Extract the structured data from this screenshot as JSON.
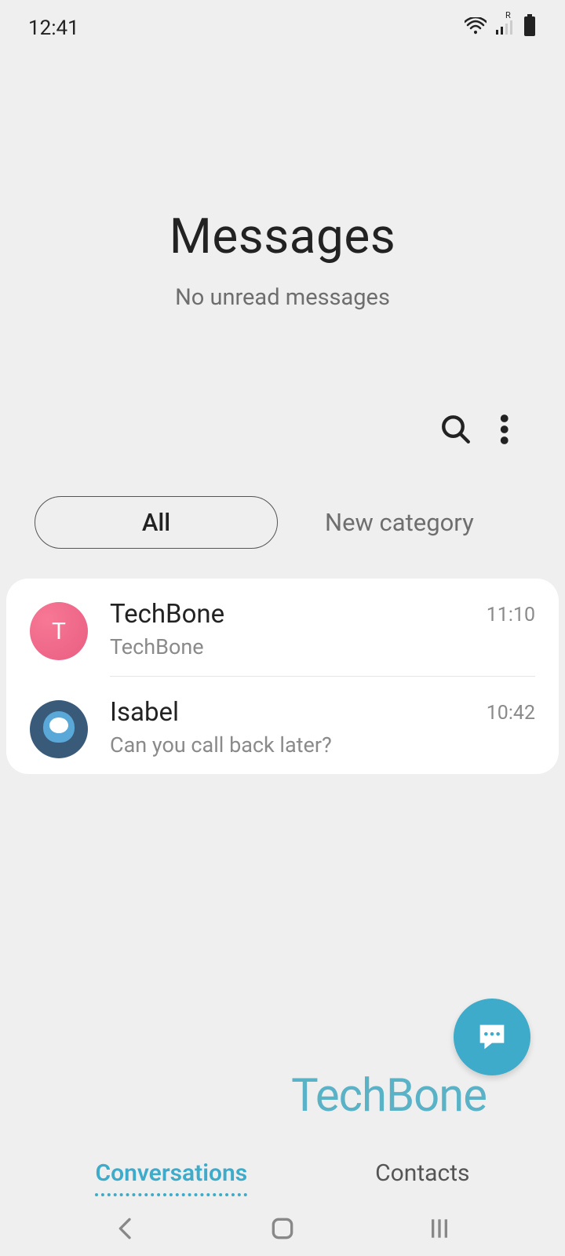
{
  "status_bar": {
    "time": "12:41",
    "signal_label": "R"
  },
  "header": {
    "title": "Messages",
    "subtitle": "No unread messages"
  },
  "category_tabs": {
    "active": "All",
    "new_category": "New category"
  },
  "conversations": [
    {
      "name": "TechBone",
      "preview": "TechBone",
      "time": "11:10",
      "avatar_letter": "T"
    },
    {
      "name": "Isabel",
      "preview": "Can you call back later?",
      "time": "10:42"
    }
  ],
  "bottom_tabs": {
    "conversations": "Conversations",
    "contacts": "Contacts"
  },
  "watermark": "TechBone"
}
